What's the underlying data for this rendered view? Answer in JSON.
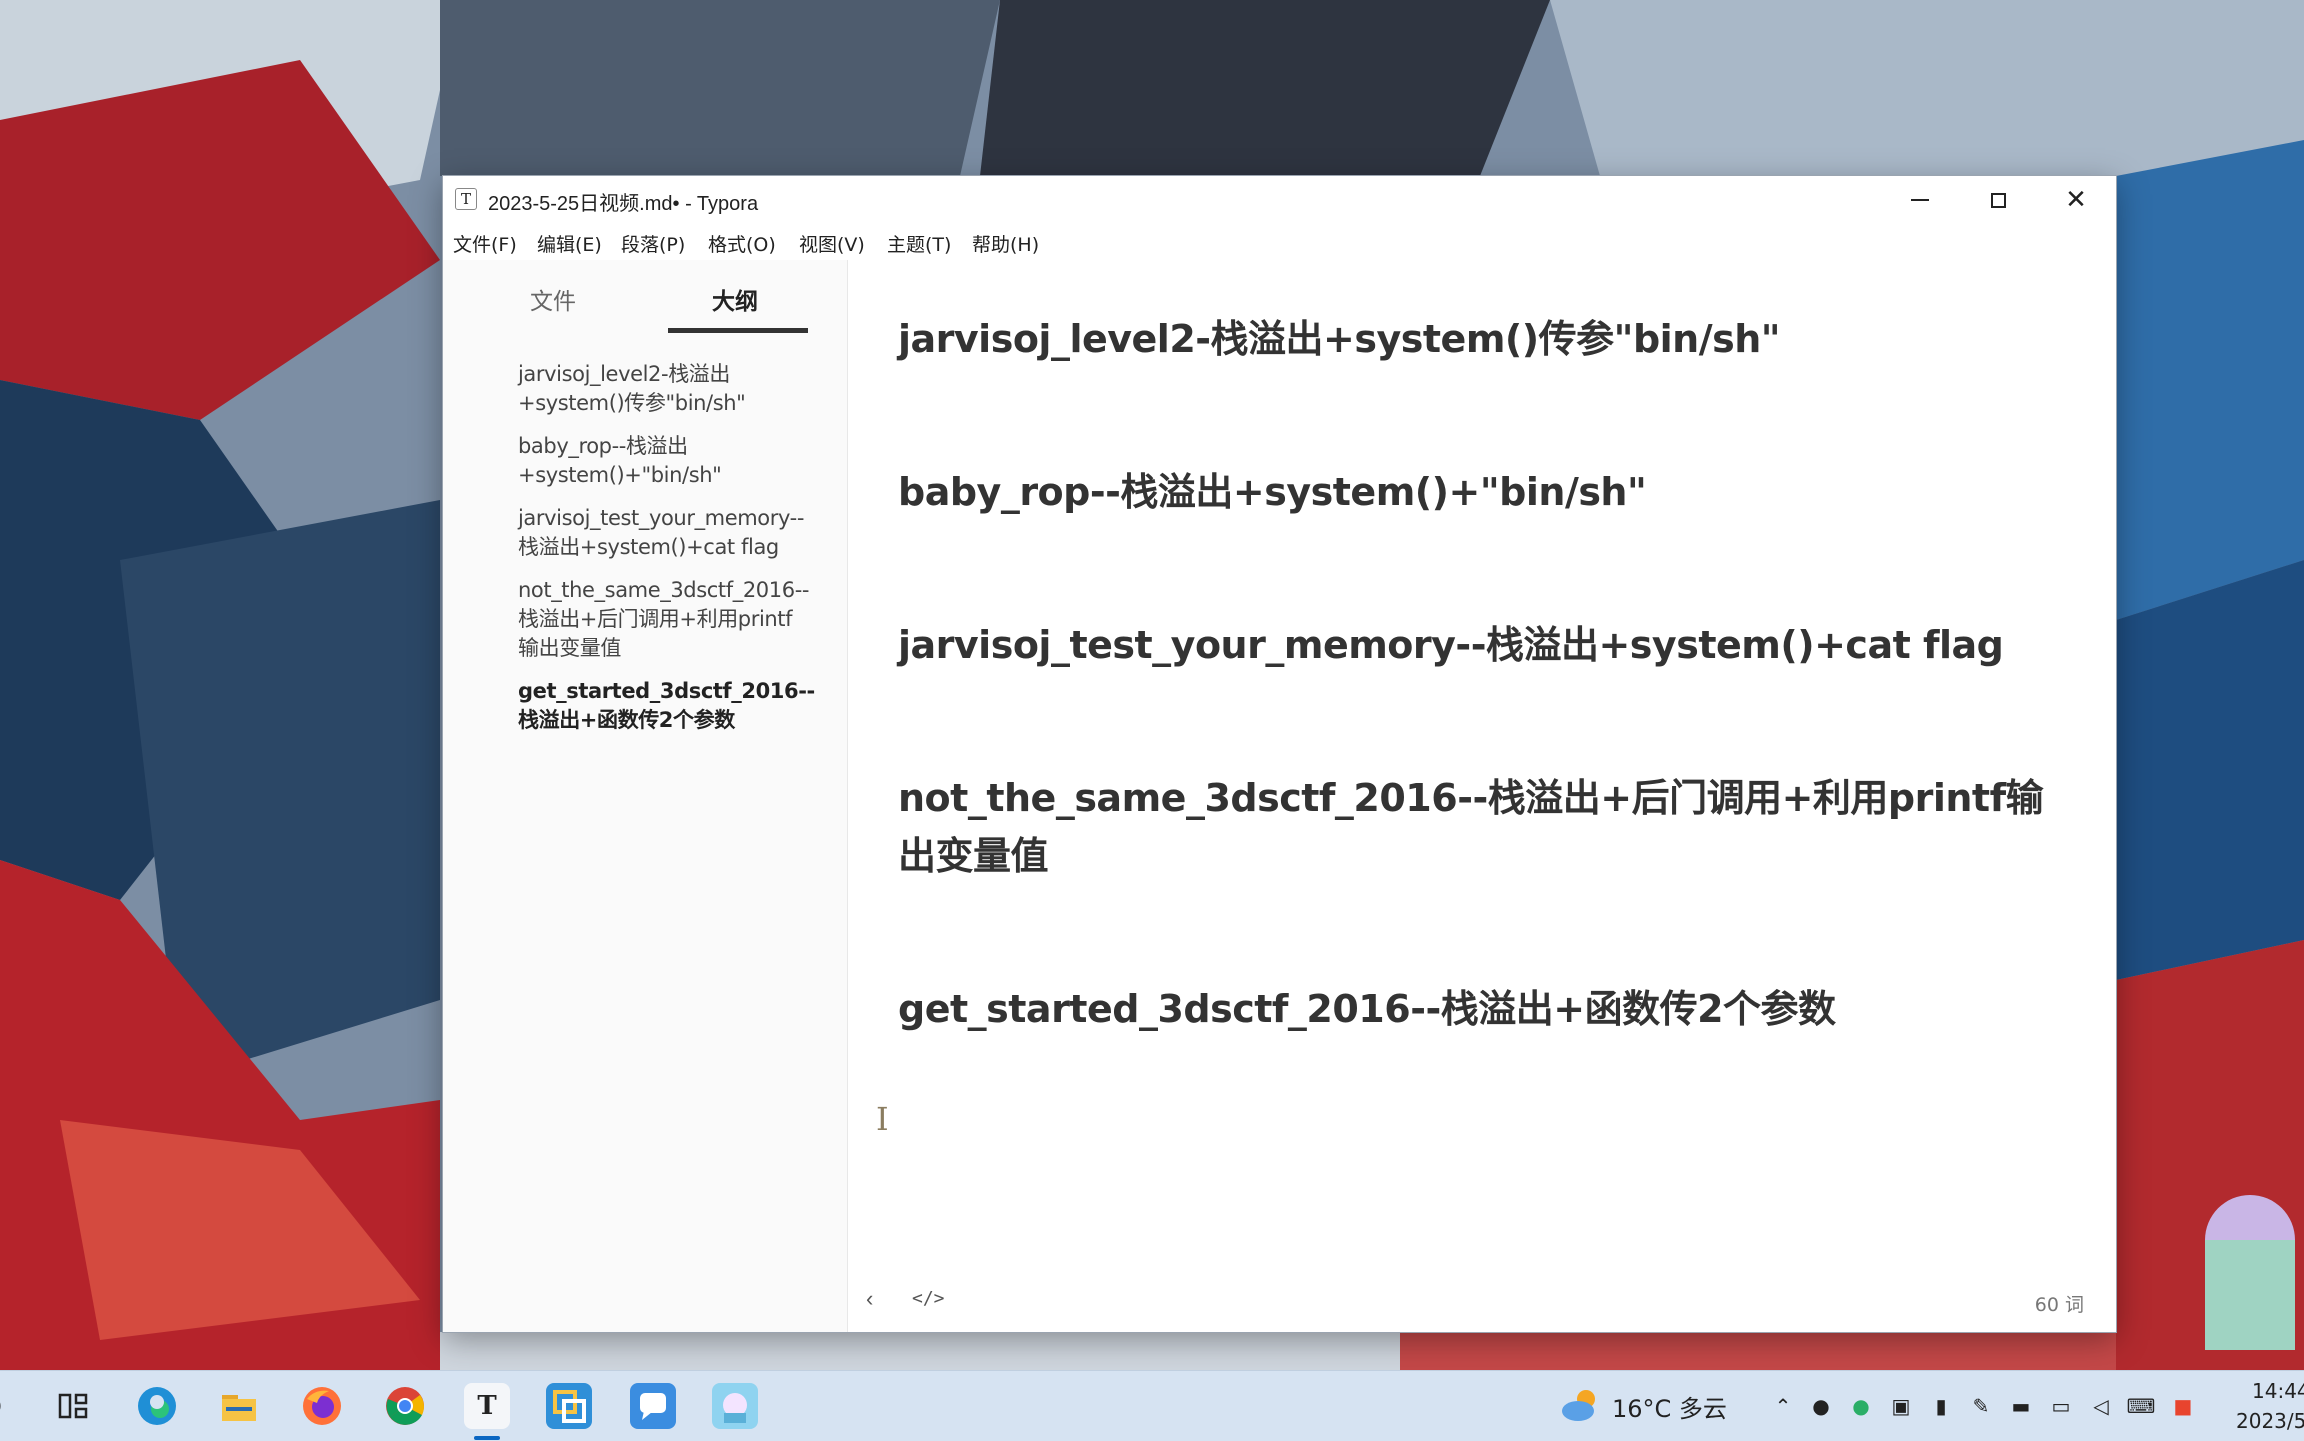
{
  "window": {
    "title": "2023-5-25日视频.md• - Typora",
    "app_icon_letter": "T"
  },
  "menu": [
    "文件(F)",
    "编辑(E)",
    "段落(P)",
    "格式(O)",
    "视图(V)",
    "主题(T)",
    "帮助(H)"
  ],
  "sidebar": {
    "tabs": {
      "files": "文件",
      "outline": "大纲"
    },
    "outline": [
      {
        "line1": "jarvisoj_level2-栈溢出",
        "line2": "+system()传参\"bin/sh\"",
        "line3": ""
      },
      {
        "line1": "baby_rop--栈溢出",
        "line2": "+system()+\"bin/sh\"",
        "line3": ""
      },
      {
        "line1": "jarvisoj_test_your_memory--",
        "line2": "栈溢出+system()+cat flag",
        "line3": ""
      },
      {
        "line1": "not_the_same_3dsctf_2016--",
        "line2": "栈溢出+后门调用+利用printf",
        "line3": "输出变量值"
      },
      {
        "line1": "get_started_3dsctf_2016--",
        "line2": "栈溢出+函数传2个参数",
        "line3": ""
      }
    ]
  },
  "editor": {
    "headings": [
      "jarvisoj_level2-栈溢出+system()传参\"bin/sh\"",
      "baby_rop--栈溢出+system()+\"bin/sh\"",
      "jarvisoj_test_your_memory--栈溢出+system()+cat flag",
      "not_the_same_3dsctf_2016--栈溢出+后门调用+利用printf输出变量值",
      "get_started_3dsctf_2016--栈溢出+函数传2个参数"
    ],
    "word_count": "60 词"
  },
  "taskbar": {
    "weather": "16°C 多云",
    "time": "14:44",
    "date": "2023/5/"
  },
  "icons": {
    "edge": "edge-icon",
    "explorer": "folder-icon",
    "firefox": "firefox-icon",
    "chrome": "chrome-icon",
    "typora": "typora-icon"
  }
}
